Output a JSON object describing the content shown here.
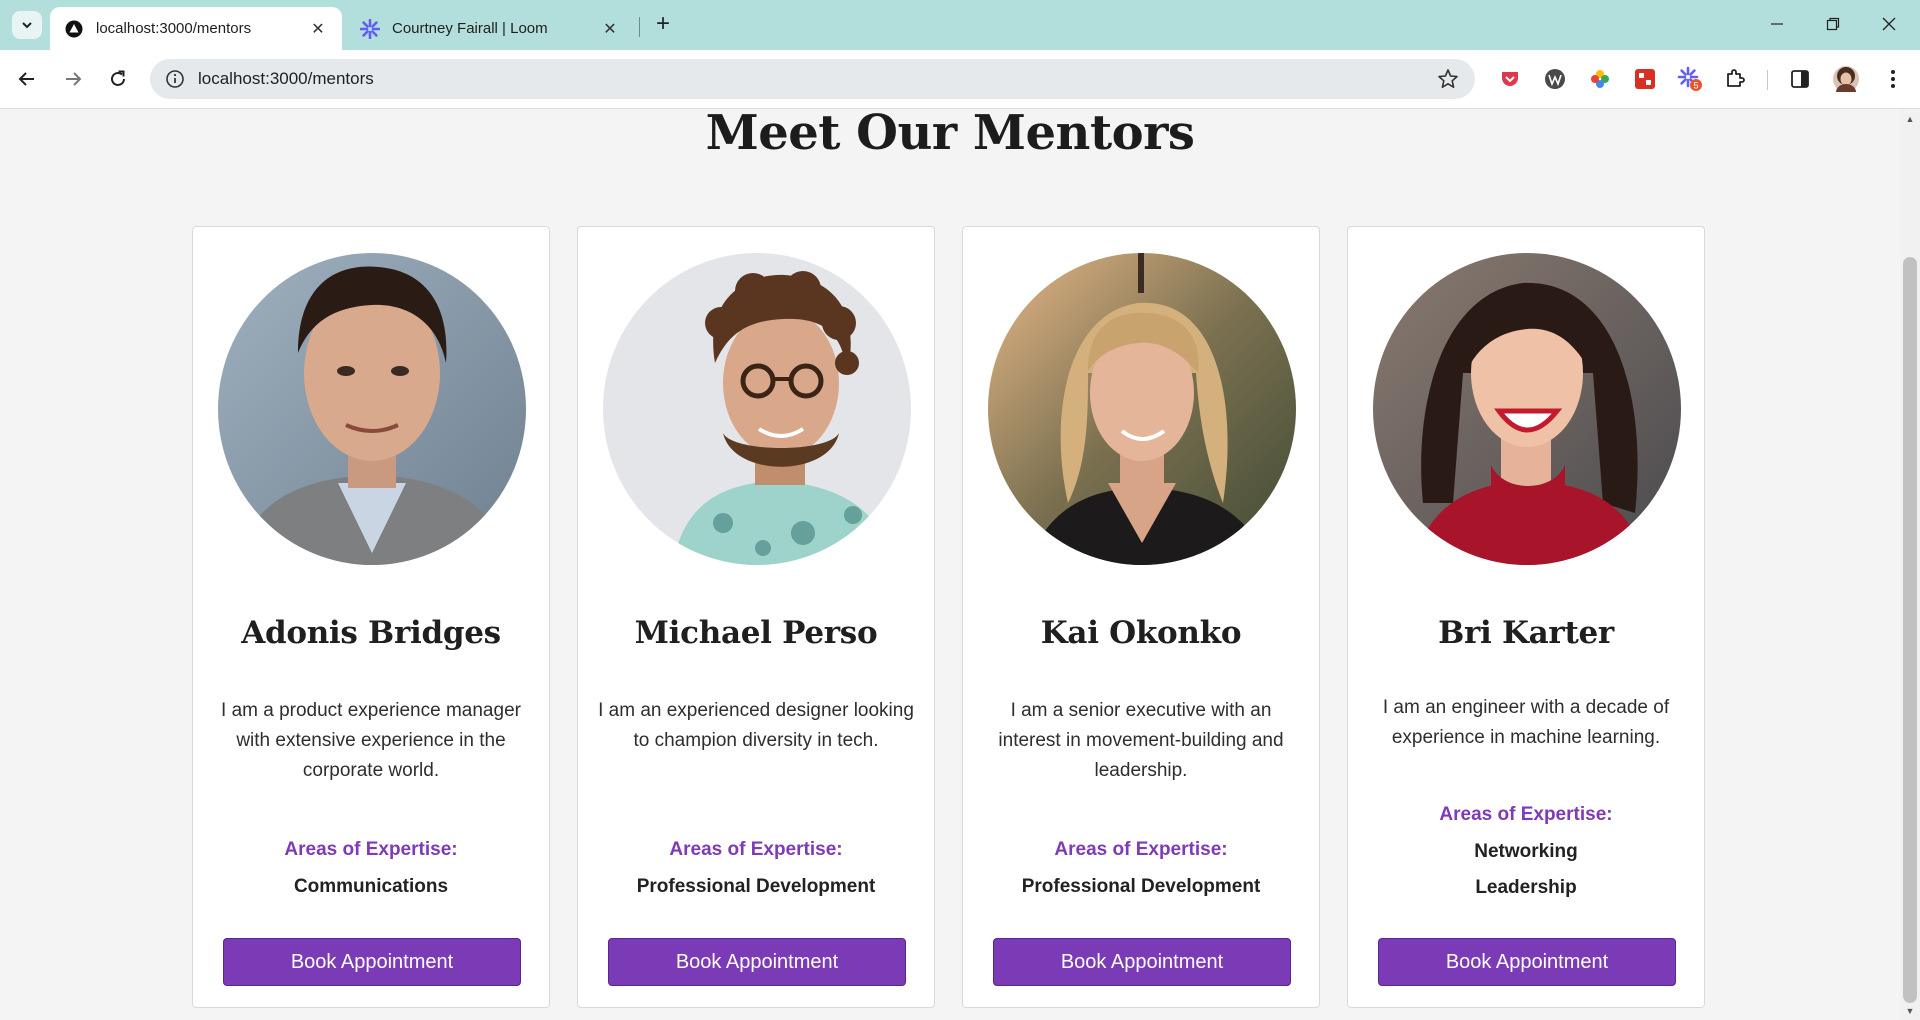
{
  "browser": {
    "tabs": [
      {
        "title": "localhost:3000/mentors",
        "favicon": "triangle-logo-icon",
        "active": true
      },
      {
        "title": "Courtney Fairall | Loom",
        "favicon": "loom-icon",
        "active": false
      }
    ],
    "url": "localhost:3000/mentors",
    "avatar": "profile-avatar",
    "extension_badge": "5"
  },
  "page": {
    "title": "Meet Our Mentors",
    "expertise_label": "Areas of Expertise:",
    "button_label": "Book Appointment",
    "accent_color": "#7b3ab6",
    "mentors": [
      {
        "name": "Adonis Bridges",
        "bio": "I am a product experience manager with extensive experience in the corporate world.",
        "expertise": [
          "Communications"
        ]
      },
      {
        "name": "Michael Perso",
        "bio": "I am an experienced designer looking to champion diversity in tech.",
        "expertise": [
          "Professional Development"
        ]
      },
      {
        "name": "Kai Okonko",
        "bio": "I am a senior executive with an interest in movement-building and leadership.",
        "expertise": [
          "Professional Development"
        ]
      },
      {
        "name": "Bri Karter",
        "bio": "I am an engineer with a decade of experience in machine learning.",
        "expertise": [
          "Networking",
          "Leadership"
        ]
      }
    ]
  }
}
